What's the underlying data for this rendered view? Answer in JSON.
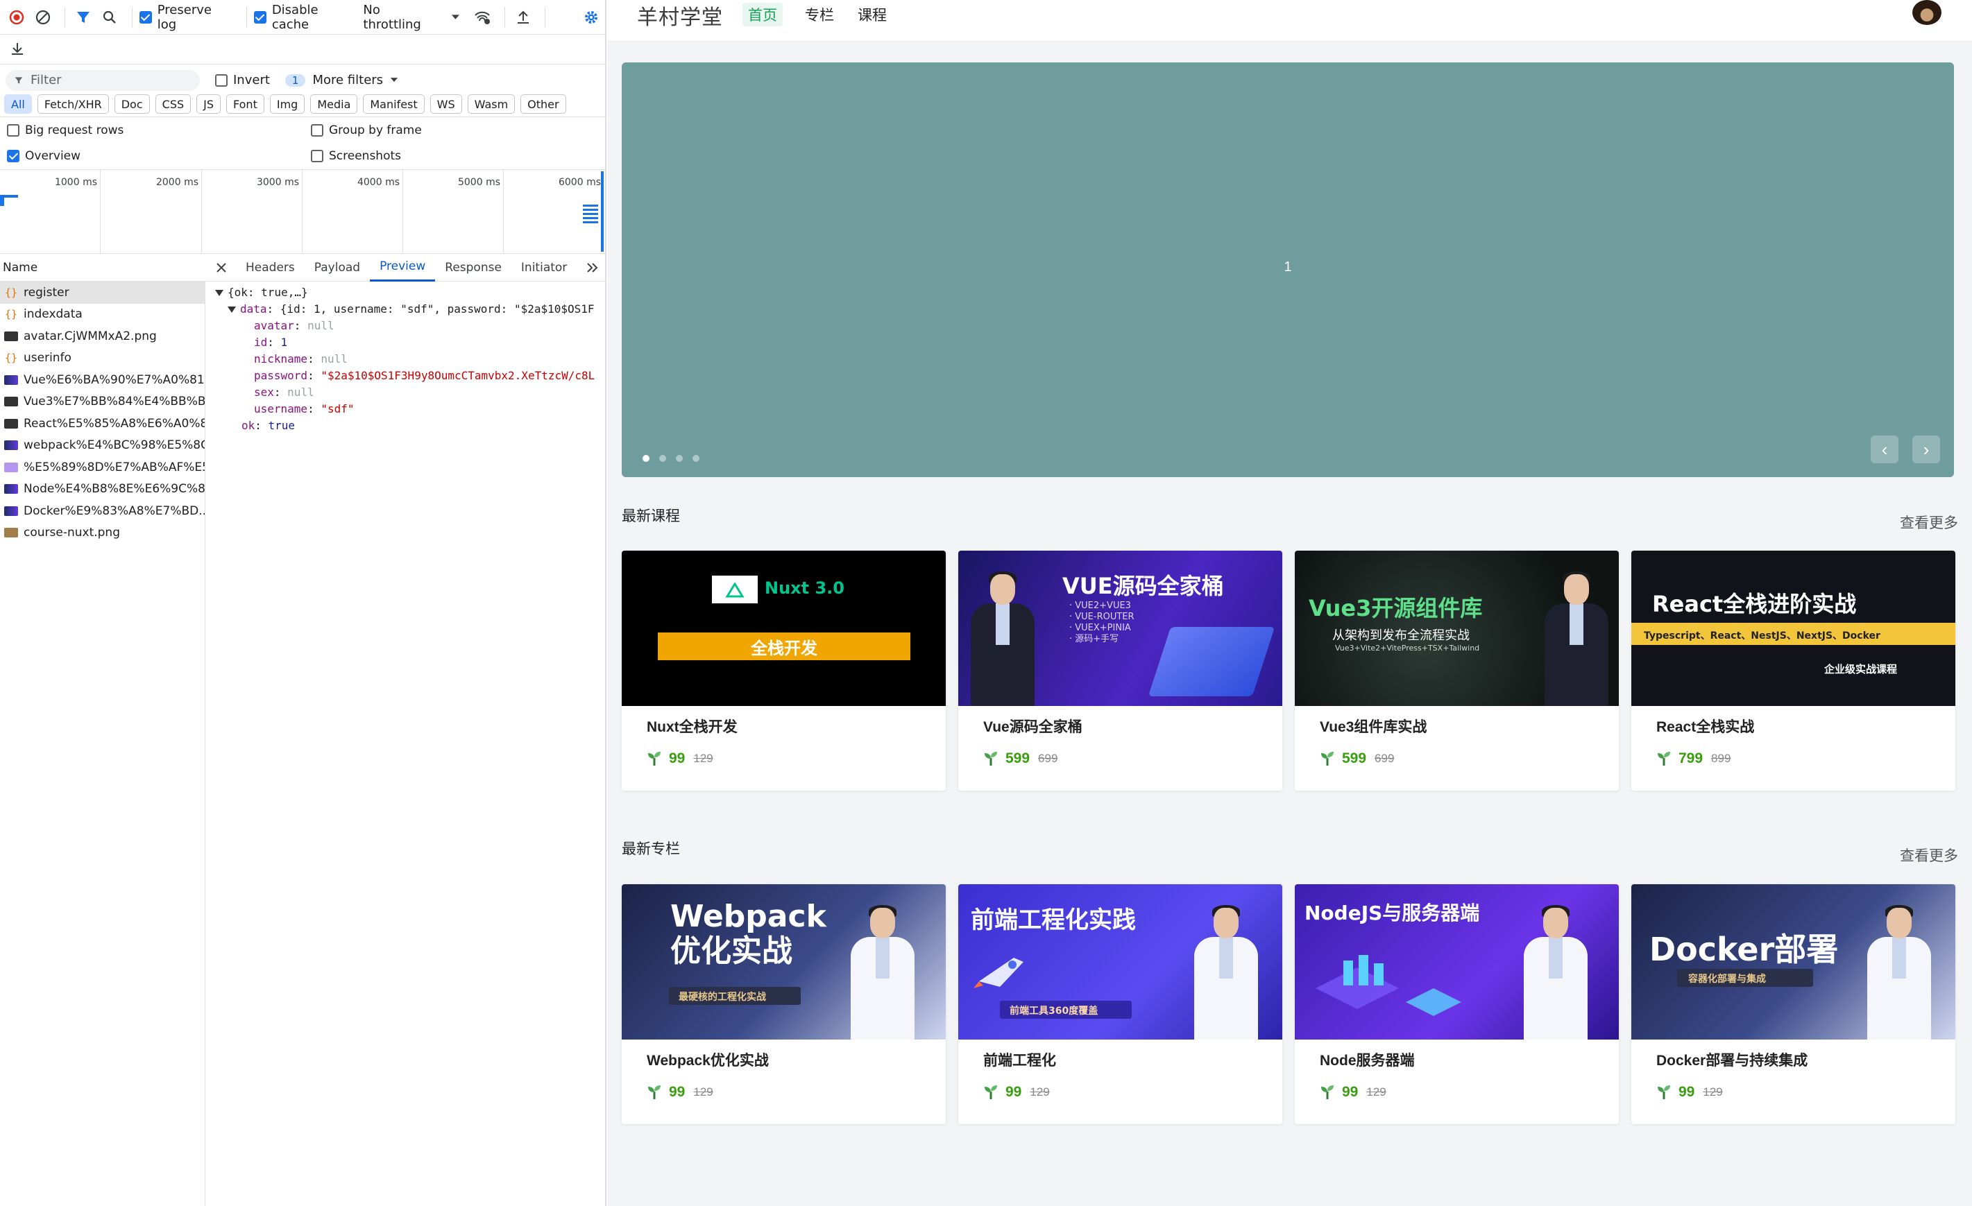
{
  "devtools": {
    "toolbar": {
      "preserve_log": "Preserve log",
      "disable_cache": "Disable cache",
      "throttling": "No throttling"
    },
    "filter": {
      "placeholder": "Filter",
      "invert": "Invert",
      "more_filters_count": "1",
      "more_filters": "More filters"
    },
    "types": [
      "All",
      "Fetch/XHR",
      "Doc",
      "CSS",
      "JS",
      "Font",
      "Img",
      "Media",
      "Manifest",
      "WS",
      "Wasm",
      "Other"
    ],
    "options": {
      "big_rows": "Big request rows",
      "group_by_frame": "Group by frame",
      "overview": "Overview",
      "screenshots": "Screenshots"
    },
    "timeline_ticks": [
      "1000 ms",
      "2000 ms",
      "3000 ms",
      "4000 ms",
      "5000 ms",
      "6000 ms"
    ],
    "name_header": "Name",
    "detail_tabs": [
      "Headers",
      "Payload",
      "Preview",
      "Response",
      "Initiator"
    ],
    "requests": [
      "register",
      "indexdata",
      "avatar.CjWMMxA2.png",
      "userinfo",
      "Vue%E6%BA%90%E7%A0%81...",
      "Vue3%E7%BB%84%E4%BB%B...",
      "React%E5%85%A8%E6%A0%8...",
      "webpack%E4%BC%98%E5%8C...",
      "%E5%89%8D%E7%AB%AF%E5...",
      "Node%E4%B8%8E%E6%9C%8...",
      "Docker%E9%83%A8%E7%BD...",
      "course-nuxt.png"
    ],
    "preview": {
      "root": "{ok: true,…}",
      "data_key": "data",
      "data_summary": "{id: 1, username: \"sdf\", password: \"$2a$10$OS1F",
      "avatar_key": "avatar",
      "avatar_val": "null",
      "id_key": "id",
      "id_val": "1",
      "nickname_key": "nickname",
      "nickname_val": "null",
      "password_key": "password",
      "password_val": "\"$2a$10$OS1F3H9y8OumcCTamvbx2.XeTtzcW/c8L",
      "sex_key": "sex",
      "sex_val": "null",
      "username_key": "username",
      "username_val": "\"sdf\"",
      "ok_key": "ok",
      "ok_val": "true"
    }
  },
  "site": {
    "logo": "羊村学堂",
    "nav": [
      "首页",
      "专栏",
      "课程"
    ],
    "carousel": {
      "label": "1",
      "prev": "‹",
      "next": "›"
    },
    "courses": {
      "title": "最新课程",
      "more": "查看更多",
      "items": [
        {
          "title": "Nuxt全栈开发",
          "price": "99",
          "original": "129"
        },
        {
          "title": "Vue源码全家桶",
          "price": "599",
          "original": "699"
        },
        {
          "title": "Vue3组件库实战",
          "price": "599",
          "original": "699"
        },
        {
          "title": "React全栈实战",
          "price": "799",
          "original": "899"
        }
      ]
    },
    "columns": {
      "title": "最新专栏",
      "more": "查看更多",
      "items": [
        {
          "title": "Webpack优化实战",
          "price": "99",
          "original": "129"
        },
        {
          "title": "前端工程化",
          "price": "99",
          "original": "129"
        },
        {
          "title": "Node服务器端",
          "price": "99",
          "original": "129"
        },
        {
          "title": "Docker部署与持续集成",
          "price": "99",
          "original": "129"
        }
      ]
    },
    "covers": {
      "nuxt_brand": "Nuxt 3.0",
      "nuxt_banner": "全栈开发",
      "vue_src_title": "VUE源码全家桶",
      "vue_src_list": [
        "· VUE2+VUE3",
        "· VUE-ROUTER",
        "· VUEX+PINIA",
        "· 源码+手写"
      ],
      "vue3_title": "Vue3开源组件库",
      "vue3_sub": "从架构到发布全流程实战",
      "vue3_stack": "Vue3+Vite2+VitePress+TSX+Tailwind",
      "react_title": "React全栈进阶实战",
      "react_stack": "Typescript、React、NestJS、NextJS、Docker",
      "react_sub": "企业级实战课程",
      "webpack_title1": "Webpack",
      "webpack_title2": "优化实战",
      "webpack_sub": "最硬核的工程化实战",
      "fe_title": "前端工程化实践",
      "fe_sub": "前端工具360度覆盖",
      "node_title": "NodeJS与服务器端",
      "docker_title": "Docker部署",
      "docker_sub": "容器化部署与集成"
    }
  }
}
